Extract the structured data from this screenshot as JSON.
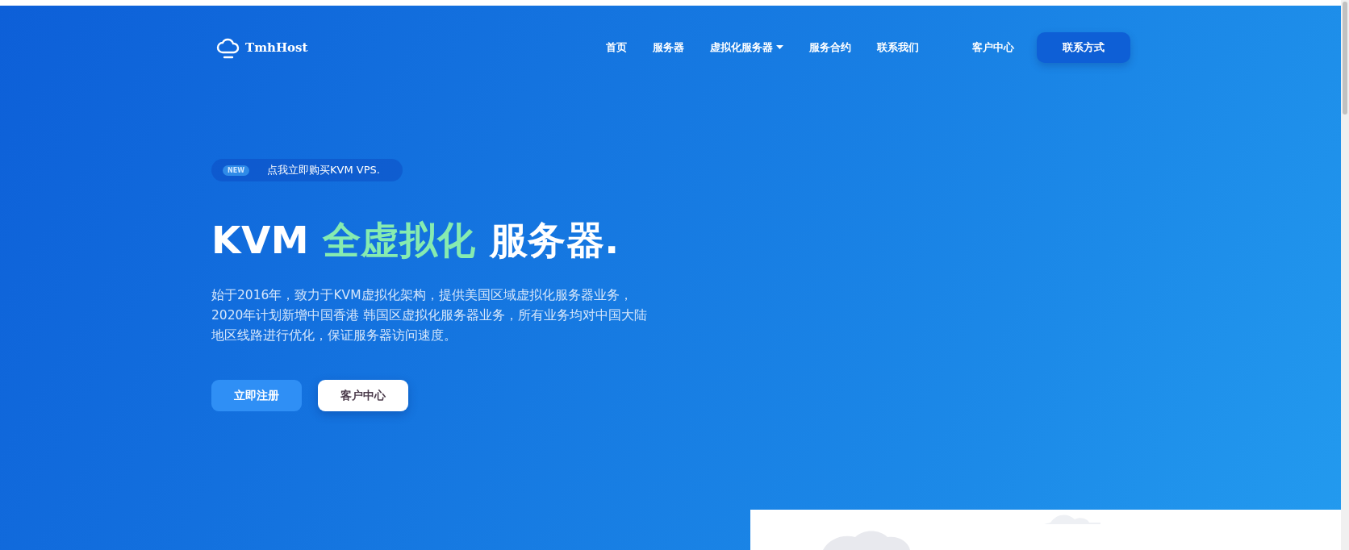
{
  "header": {
    "logo": "TmhHost",
    "nav": [
      {
        "label": "首页",
        "kind": "link"
      },
      {
        "label": "服务器",
        "kind": "link"
      },
      {
        "label": "虚拟化服务器",
        "kind": "dropdown"
      },
      {
        "label": "服务合约",
        "kind": "link"
      },
      {
        "label": "联系我们",
        "kind": "link"
      }
    ],
    "account_link": "客户中心",
    "contact_button": "联系方式"
  },
  "hero": {
    "badge": {
      "tag": "NEW",
      "text": "点我立即购买KVM VPS."
    },
    "heading": [
      {
        "text": "KVM ",
        "highlight": false
      },
      {
        "text": "全虚拟化",
        "highlight": true
      },
      {
        "text": " 服务器.",
        "highlight": false
      }
    ],
    "description_lines": [
      "始于2016年，致力于KVM虚拟化架构，提供美国区域虚拟化服务器业务，",
      "2020年计划新增中国香港 韩国区虚拟化服务器业务，所有业务均对中国大陆",
      "地区线路进行优化，保证服务器访问速度。"
    ],
    "buttons": [
      {
        "label": "立即注册",
        "kind": "primary"
      },
      {
        "label": "客户中心",
        "kind": "secondary"
      }
    ]
  }
}
